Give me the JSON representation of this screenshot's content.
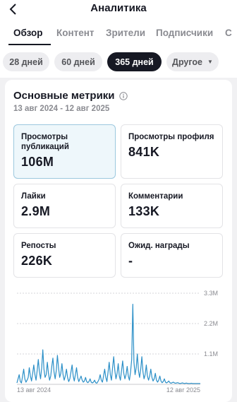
{
  "header": {
    "title": "Аналитика",
    "back_icon": "chevron-left-icon"
  },
  "tabs": [
    {
      "label": "Обзор",
      "active": true
    },
    {
      "label": "Контент",
      "active": false
    },
    {
      "label": "Зрители",
      "active": false
    },
    {
      "label": "Подписчики",
      "active": false
    },
    {
      "label": "С",
      "active": false
    }
  ],
  "periods": [
    {
      "label": "28 дней",
      "active": false
    },
    {
      "label": "60 дней",
      "active": false
    },
    {
      "label": "365 дней",
      "active": true
    },
    {
      "label": "Другое",
      "active": false,
      "icon": "caret-down-icon"
    }
  ],
  "metrics_card": {
    "title": "Основные метрики",
    "info_icon": "info-icon",
    "date_range": "13 авг 2024 - 12 авг 2025",
    "tiles": [
      {
        "label": "Просмотры публикаций",
        "value": "106M",
        "selected": true
      },
      {
        "label": "Просмотры профиля",
        "value": "841K",
        "selected": false
      },
      {
        "label": "Лайки",
        "value": "2.9M",
        "selected": false
      },
      {
        "label": "Комментарии",
        "value": "133K",
        "selected": false
      },
      {
        "label": "Репосты",
        "value": "226K",
        "selected": false
      },
      {
        "label": "Ожид. награды",
        "value": "-",
        "selected": false
      }
    ]
  },
  "chart_data": {
    "type": "line",
    "color": "#2b8fc7",
    "ytick_labels": [
      "3.3M",
      "2.2M",
      "1.1M"
    ],
    "yticks": [
      3.3,
      2.2,
      1.1
    ],
    "ylim": [
      0,
      3.3
    ],
    "x_labels": [
      "13 авг 2024",
      "12 авг 2025"
    ],
    "values": [
      0.05,
      0.2,
      0.35,
      0.1,
      0.05,
      0.3,
      0.55,
      0.2,
      0.08,
      0.15,
      0.25,
      0.6,
      0.3,
      0.12,
      0.4,
      0.7,
      0.35,
      0.15,
      0.5,
      0.9,
      0.45,
      0.2,
      0.6,
      1.25,
      0.55,
      0.25,
      0.35,
      0.8,
      0.4,
      0.15,
      0.3,
      0.65,
      0.95,
      0.45,
      0.2,
      0.5,
      1.05,
      0.6,
      0.25,
      0.4,
      0.75,
      0.35,
      0.15,
      0.3,
      0.55,
      0.25,
      0.1,
      0.2,
      0.45,
      0.7,
      0.3,
      0.12,
      0.35,
      0.6,
      0.25,
      0.1,
      0.2,
      0.3,
      0.15,
      0.08,
      0.12,
      0.25,
      0.1,
      0.06,
      0.1,
      0.2,
      0.08,
      0.05,
      0.08,
      0.15,
      0.06,
      0.04,
      0.1,
      0.18,
      0.35,
      0.15,
      0.08,
      0.3,
      0.55,
      0.25,
      0.1,
      0.45,
      0.8,
      0.35,
      0.15,
      0.6,
      1.0,
      0.5,
      0.2,
      0.4,
      0.75,
      0.3,
      0.15,
      0.5,
      0.85,
      0.4,
      0.2,
      0.35,
      0.65,
      0.3,
      0.15,
      0.45,
      0.9,
      2.9,
      0.8,
      0.35,
      0.6,
      1.1,
      0.5,
      0.25,
      0.55,
      1.0,
      0.45,
      0.2,
      0.35,
      0.7,
      0.3,
      0.15,
      0.3,
      0.55,
      0.25,
      0.12,
      0.2,
      0.4,
      0.15,
      0.08,
      0.15,
      0.3,
      0.12,
      0.06,
      0.1,
      0.2,
      0.08,
      0.05,
      0.08,
      0.12,
      0.06,
      0.04,
      0.06,
      0.08,
      0.05,
      0.04,
      0.05,
      0.06,
      0.04,
      0.03,
      0.04,
      0.05,
      0.04,
      0.03,
      0.04,
      0.04,
      0.03,
      0.03,
      0.03,
      0.04,
      0.03,
      0.03,
      0.03,
      0.03,
      0.03,
      0.03,
      0.03,
      0.03
    ]
  }
}
